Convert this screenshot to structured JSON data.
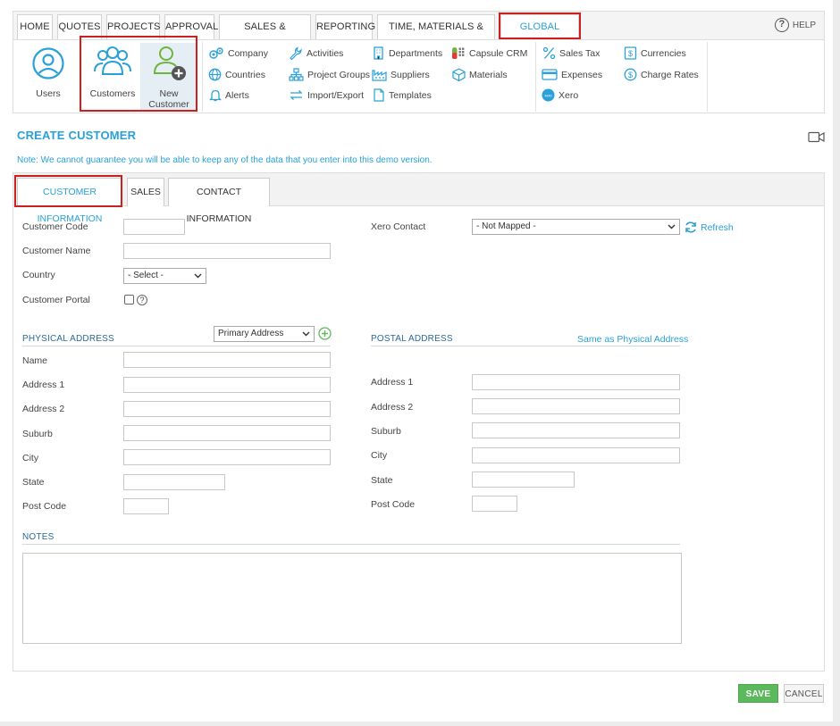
{
  "nav": {
    "tabs": [
      "HOME",
      "QUOTES",
      "PROJECTS",
      "APPROVAL",
      "SALES & PURCHASES",
      "REPORTING",
      "TIME, MATERIALS & EXPENSES",
      "GLOBAL SETTINGS"
    ],
    "active_tab": "GLOBAL SETTINGS",
    "help_label": "HELP"
  },
  "ribbon": {
    "users_label": "Users",
    "customers_label": "Customers",
    "new_customer_label_1": "New",
    "new_customer_label_2": "Customer",
    "links": {
      "company": "Company",
      "countries": "Countries",
      "alerts": "Alerts",
      "activities": "Activities",
      "project_groups": "Project Groups",
      "import_export": "Import/Export",
      "departments": "Departments",
      "suppliers": "Suppliers",
      "templates": "Templates",
      "capsule_crm": "Capsule CRM",
      "materials": "Materials",
      "sales_tax": "Sales Tax",
      "expenses": "Expenses",
      "xero": "Xero",
      "currencies": "Currencies",
      "charge_rates": "Charge Rates"
    },
    "xero_badge": "xero"
  },
  "page": {
    "title": "CREATE CUSTOMER",
    "note": "Note: We cannot guarantee you will be able to keep any of the data that you enter into this demo version."
  },
  "form_tabs": [
    "CUSTOMER INFORMATION",
    "SALES",
    "CONTACT INFORMATION"
  ],
  "active_form_tab": "CUSTOMER INFORMATION",
  "customer": {
    "code_label": "Customer Code",
    "code_value": "",
    "name_label": "Customer Name",
    "name_value": "",
    "country_label": "Country",
    "country_value": "- Select -",
    "portal_label": "Customer Portal",
    "portal_checked": false
  },
  "xero": {
    "contact_label": "Xero Contact",
    "contact_value": "- Not Mapped -",
    "refresh_label": "Refresh"
  },
  "physical": {
    "title": "PHYSICAL ADDRESS",
    "address_type": "Primary Address",
    "name_label": "Name",
    "address1_label": "Address 1",
    "address2_label": "Address 2",
    "suburb_label": "Suburb",
    "city_label": "City",
    "state_label": "State",
    "postcode_label": "Post Code"
  },
  "postal": {
    "title": "POSTAL ADDRESS",
    "same_as_label": "Same as Physical Address",
    "address1_label": "Address 1",
    "address2_label": "Address 2",
    "suburb_label": "Suburb",
    "city_label": "City",
    "state_label": "State",
    "postcode_label": "Post Code"
  },
  "notes": {
    "title": "NOTES",
    "value": ""
  },
  "actions": {
    "save_label": "SAVE",
    "cancel_label": "CANCEL"
  },
  "colors": {
    "accent": "#2aa0d8",
    "highlight_box": "#cc1f1f",
    "save_green": "#5cb85c"
  }
}
